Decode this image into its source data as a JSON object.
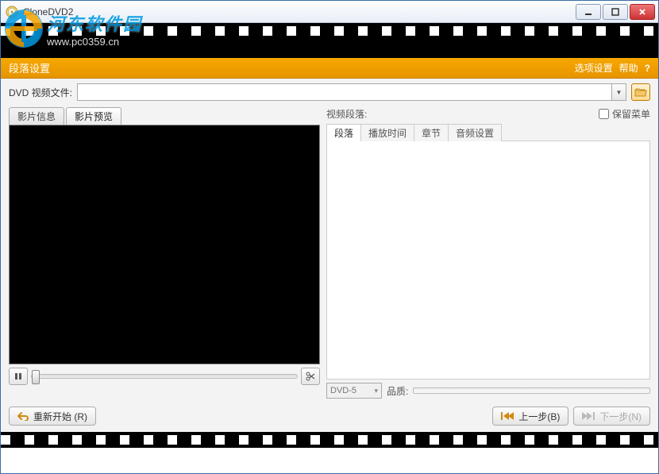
{
  "window": {
    "title": "CloneDVD2"
  },
  "watermark": {
    "cn": "河东软件园",
    "url": "www.pc0359.cn"
  },
  "header": {
    "title": "段落设置",
    "option": "选项设置",
    "help": "帮助",
    "q": "?"
  },
  "file": {
    "label": "DVD 视频文件:",
    "value": ""
  },
  "left_tabs": {
    "active": 1,
    "items": [
      {
        "label": "影片信息"
      },
      {
        "label": "影片预览"
      }
    ]
  },
  "right": {
    "label": "视频段落:",
    "keep_menu": "保留菜单",
    "tabs": {
      "active": 0,
      "items": [
        {
          "label": "段落"
        },
        {
          "label": "播放时间"
        },
        {
          "label": "章节"
        },
        {
          "label": "音频设置"
        }
      ]
    }
  },
  "quality": {
    "target": "DVD-5",
    "label": "品质:"
  },
  "nav": {
    "restart": "重新开始 (R)",
    "prev": "上一步(B)",
    "next": "下一步(N)"
  }
}
